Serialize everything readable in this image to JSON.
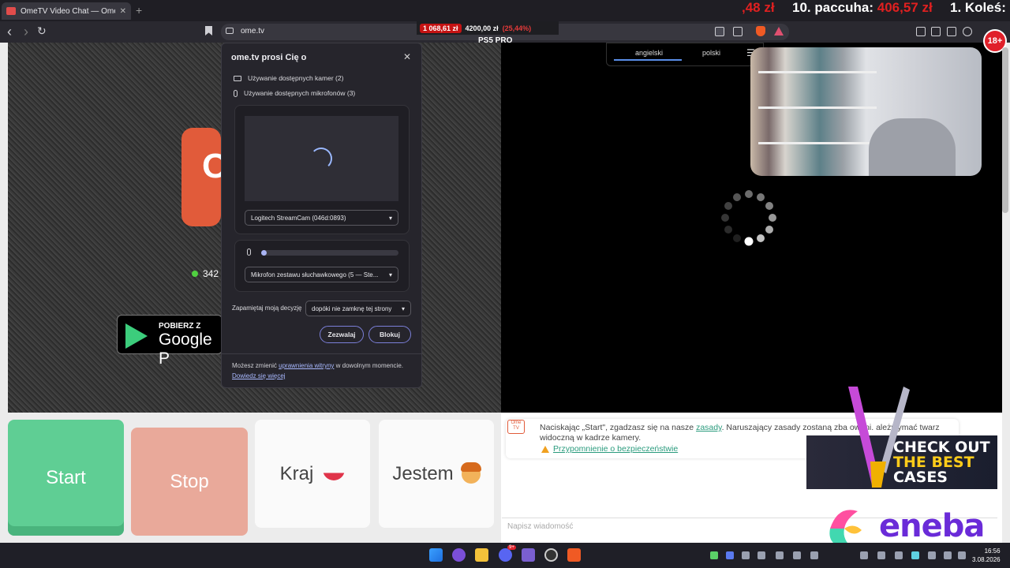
{
  "browser": {
    "tab_title": "OmeTV Video Chat — Omegle R",
    "tab_close": "✕",
    "new_tab": "+",
    "url": "ome.tv",
    "nav_back": "‹",
    "nav_forward": "›",
    "nav_reload": "↻"
  },
  "stream_overlay": {
    "item1_amount": ",48 zł",
    "item2_label": "10. paccuha:",
    "item2_amount": "406,57 zł",
    "item3_label": "1. Koleś:",
    "item3_amount": "(",
    "ticker_price1": "1 068,61 zł",
    "ticker_price2": "4200,00 zł",
    "ticker_change": "(25,44%)",
    "ps5": "PS5 PRO"
  },
  "age_badge": "18+",
  "permission_dialog": {
    "site": "ome.tv",
    "title_suffix": "prosi Cię o",
    "close": "✕",
    "perm_camera": "Używanie dostępnych kamer (2)",
    "perm_mic": "Używanie dostępnych mikrofonów (3)",
    "camera_select": "Logitech StreamCam (046d:0893)",
    "mic_select": "Mikrofon zestawu słuchawkowego (5 — Ste...",
    "remember_label": "Zapamiętaj moją decyzję",
    "remember_select": "dopóki nie zamknę tej strony",
    "allow": "Zezwalaj",
    "block": "Blokuj",
    "footnote_pre": "Możesz zmienić",
    "footnote_link": "uprawnienia witryny",
    "footnote_post": "w dowolnym momencie.",
    "learn_more": "Dowiedz się więcej"
  },
  "left_video": {
    "online_count": "342",
    "gplay_small": "POBIERZ Z",
    "gplay_big": "Google P"
  },
  "language_tabs": {
    "active": "angielski",
    "other": "polski",
    "menu": "☰"
  },
  "controls": {
    "start": "Start",
    "stop": "Stop",
    "country": "Kraj",
    "gender": "Jestem"
  },
  "chat": {
    "logo_text": "Ome TV",
    "msg_pre": "Naciskając „Start\", zgadzasz się na nasze",
    "msg_link": "zasady",
    "msg_post": ". Naruszający zasady zostaną zba  owani.   ależy   ymać twarz widoczną w kadrze kamery.",
    "reminder": "Przypomnienie o bezpieczeństwie",
    "placeholder": "Napisz wiadomość"
  },
  "ads": {
    "cases_line1": "CHECK OUT",
    "cases_line2": "THE BEST",
    "cases_line3": "CASES",
    "eneba": "eneba"
  },
  "taskbar": {
    "time": "16:56",
    "date": "3.08.2026",
    "discord_badge": "9+"
  },
  "colors": {
    "start": "#5fce94",
    "stop": "#e9a99a",
    "accent": "#7b7fd8",
    "link": "#2a9b7d",
    "eneba": "#6a2bd8"
  }
}
